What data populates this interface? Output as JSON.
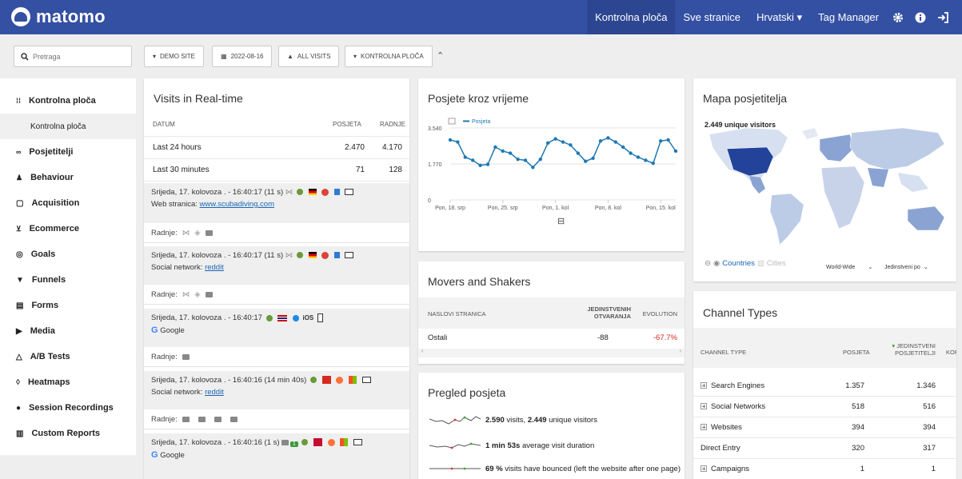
{
  "topbar": {
    "logo": "matomo",
    "nav": [
      "Kontrolna ploča",
      "Sve stranice",
      "Hrvatski",
      "Tag Manager"
    ],
    "icons": [
      "gear-icon",
      "info-icon",
      "logout-icon"
    ]
  },
  "search": {
    "placeholder": "Pretraga"
  },
  "selectors": {
    "site": "DEMO SITE",
    "date": "2022-08-16",
    "segment": "ALL VISITS",
    "dashboard": "KONTROLNA PLOČA"
  },
  "sidebar": {
    "items": [
      {
        "label": "Kontrolna ploča",
        "icon": "dashboard-icon"
      },
      {
        "label": "Kontrolna ploča",
        "icon": ""
      },
      {
        "label": "Posjetitelji",
        "icon": "visitors-icon"
      },
      {
        "label": "Behaviour",
        "icon": "behaviour-icon"
      },
      {
        "label": "Acquisition",
        "icon": "acquisition-icon"
      },
      {
        "label": "Ecommerce",
        "icon": "cart-icon"
      },
      {
        "label": "Goals",
        "icon": "goal-icon"
      },
      {
        "label": "Funnels",
        "icon": "funnel-icon"
      },
      {
        "label": "Forms",
        "icon": "form-icon"
      },
      {
        "label": "Media",
        "icon": "media-icon"
      },
      {
        "label": "A/B Tests",
        "icon": "flask-icon"
      },
      {
        "label": "Heatmaps",
        "icon": "heatmap-icon"
      },
      {
        "label": "Session Recordings",
        "icon": "record-icon"
      },
      {
        "label": "Custom Reports",
        "icon": "report-icon"
      }
    ]
  },
  "realtime": {
    "title": "Visits in Real-time",
    "columns": [
      "DATUM",
      "POSJETA",
      "RADNJE"
    ],
    "rows": [
      {
        "label": "Last 24 hours",
        "visits": "2.470",
        "actions": "4.170"
      },
      {
        "label": "Last 30 minutes",
        "visits": "71",
        "actions": "128"
      }
    ],
    "visits": [
      {
        "time": "Srijeda, 17. kolovoza . - 16:40:17 (11 s)",
        "src_label": "Web stranica:",
        "src": "www.scubadiving.com",
        "actions_label": "Radnje:"
      },
      {
        "time": "Srijeda, 17. kolovoza . - 16:40:17 (11 s)",
        "src_label": "Social network:",
        "src": "reddit",
        "actions_label": "Radnje:"
      },
      {
        "time": "Srijeda, 17. kolovoza . - 16:40:17",
        "src_label": "",
        "src": "Google",
        "os": "iOS",
        "actions_label": "Radnje:"
      },
      {
        "time": "Srijeda, 17. kolovoza . - 16:40:16 (14 min 40s)",
        "src_label": "Social network:",
        "src": "reddit",
        "actions_label": "Radnje:"
      },
      {
        "time": "Srijeda, 17. kolovoza . - 16:40:16 (1 s)",
        "src_label": "",
        "src": "Google",
        "badge": "1"
      }
    ]
  },
  "chart_data": {
    "type": "line",
    "title": "Posjete kroz vrijeme",
    "series": [
      {
        "name": "Posjeta",
        "values": [
          2950,
          2850,
          2100,
          1950,
          1700,
          1750,
          2600,
          2400,
          2300,
          2000,
          1950,
          1600,
          2000,
          2800,
          3000,
          2850,
          2700,
          2300,
          1900,
          2050,
          2900,
          3050,
          2850,
          2600,
          2300,
          2100,
          1950,
          1800,
          2900,
          2950,
          2400
        ]
      }
    ],
    "x_ticks": [
      "Pon, 18. srp",
      "Pon, 25. srp",
      "Pon, 1. kol",
      "Pon, 8. kol",
      "Pon, 15. kol"
    ],
    "y_ticks": [
      "0",
      "1.770",
      "3.540"
    ],
    "ylim": [
      0,
      3540
    ],
    "color": "#1f78b4"
  },
  "movers": {
    "title": "Movers and Shakers",
    "columns": [
      "NASLOVI STRANICA",
      "JEDINSTVENIH OTVARANJA",
      "EVOLUTION"
    ],
    "row": {
      "label": "Ostali",
      "value": "-88",
      "evolution": "-67.7%"
    }
  },
  "overview": {
    "title": "Pregled posjeta",
    "lines": [
      {
        "bold": "2.590",
        "text": " visits, ",
        "bold2": "2.449",
        "text2": " unique visitors"
      },
      {
        "bold": "1 min 53s",
        "text": " average visit duration",
        "bold2": "",
        "text2": ""
      },
      {
        "bold": "69 %",
        "text": " visits have bounced (left the website after one page)",
        "bold2": "",
        "text2": ""
      }
    ]
  },
  "map": {
    "title": "Mapa posjetitelja",
    "unique": "2.449 unique visitors",
    "countries": "Countries",
    "cities": "Cities",
    "region": "World-Wide",
    "metric": "Jedinstveni po"
  },
  "channels": {
    "title": "Channel Types",
    "columns": [
      "CHANNEL TYPE",
      "POSJETA",
      "JEDINSTVENI POSJETITELJI",
      "KOR"
    ],
    "rows": [
      {
        "label": "Search Engines",
        "visits": "1.357",
        "unique": "1.346",
        "expand": true
      },
      {
        "label": "Social Networks",
        "visits": "518",
        "unique": "516",
        "expand": true
      },
      {
        "label": "Websites",
        "visits": "394",
        "unique": "394",
        "expand": true
      },
      {
        "label": "Direct Entry",
        "visits": "320",
        "unique": "317",
        "expand": false
      },
      {
        "label": "Campaigns",
        "visits": "1",
        "unique": "1",
        "expand": true
      }
    ]
  }
}
